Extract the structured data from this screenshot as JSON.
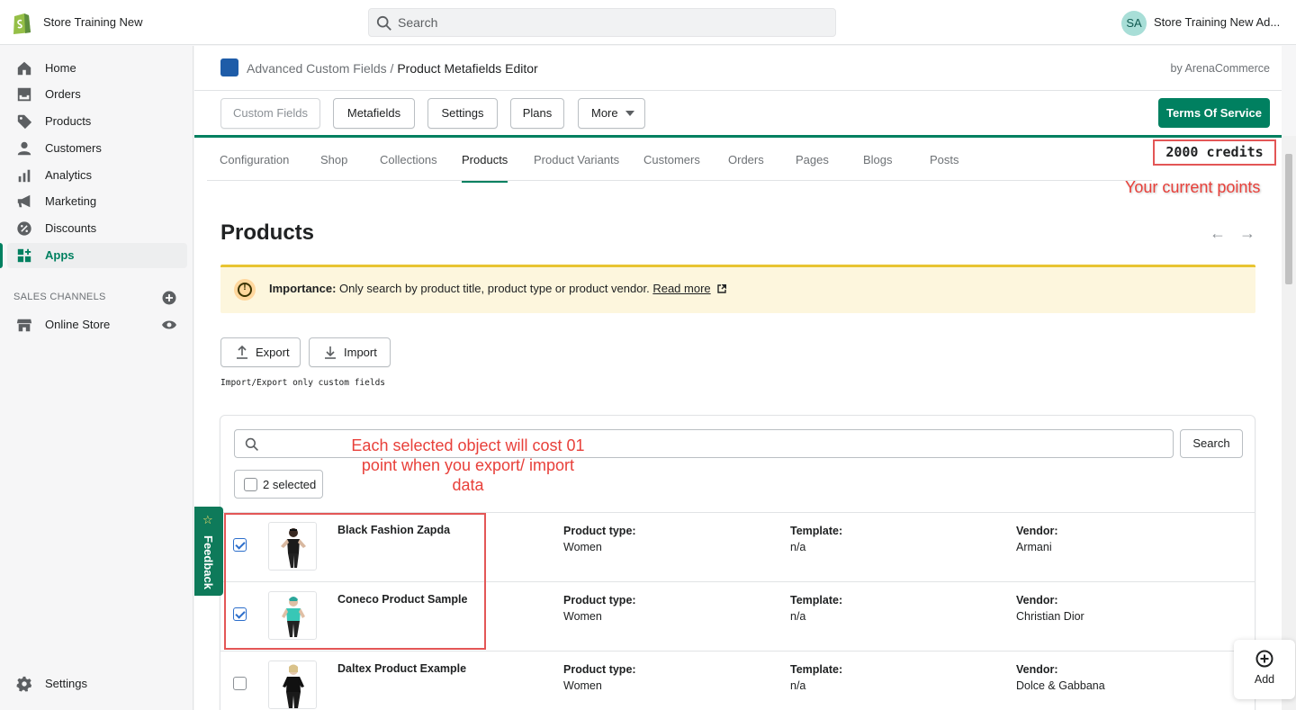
{
  "topbar": {
    "store_name": "Store Training New",
    "search_placeholder": "Search",
    "avatar_initials": "SA",
    "user_name": "Store Training New Ad..."
  },
  "sidebar": {
    "items": [
      {
        "label": "Home",
        "icon": "home-icon"
      },
      {
        "label": "Orders",
        "icon": "orders-icon"
      },
      {
        "label": "Products",
        "icon": "tag-icon"
      },
      {
        "label": "Customers",
        "icon": "person-icon"
      },
      {
        "label": "Analytics",
        "icon": "bar-chart-icon"
      },
      {
        "label": "Marketing",
        "icon": "megaphone-icon"
      },
      {
        "label": "Discounts",
        "icon": "discount-icon"
      },
      {
        "label": "Apps",
        "icon": "apps-icon"
      }
    ],
    "channels_title": "SALES CHANNELS",
    "online_store": "Online Store",
    "settings": "Settings"
  },
  "app": {
    "breadcrumb_parent": "Advanced Custom Fields",
    "breadcrumb_sep": " / ",
    "breadcrumb_current": "Product Metafields Editor",
    "byline": "by ArenaCommerce"
  },
  "toolbar": {
    "custom_fields": "Custom Fields",
    "metafields": "Metafields",
    "settings": "Settings",
    "plans": "Plans",
    "more": "More",
    "terms": "Terms Of Service"
  },
  "tabs": [
    "Configuration",
    "Shop",
    "Collections",
    "Products",
    "Product Variants",
    "Customers",
    "Orders",
    "Pages",
    "Blogs",
    "Posts"
  ],
  "credits": "2000 credits",
  "points_note": "Your current points",
  "page_title": "Products",
  "banner": {
    "label": "Importance:",
    "text": " Only search by product title, product type or product vendor. ",
    "link": "Read more"
  },
  "export_label": "Export",
  "import_label": "Import",
  "ie_note": "Import/Export only custom fields",
  "list": {
    "search_button": "Search",
    "selected": "2 selected",
    "cost_note": "Each selected object will cost 01 point when you export/ import data",
    "col_type": "Product type:",
    "col_template": "Template:",
    "col_vendor": "Vendor:",
    "rows": [
      {
        "name": "Black Fashion Zapda",
        "type": "Women",
        "template": "n/a",
        "vendor": "Armani",
        "checked": true
      },
      {
        "name": "Coneco Product Sample",
        "type": "Women",
        "template": "n/a",
        "vendor": "Christian Dior",
        "checked": true
      },
      {
        "name": "Daltex Product Example",
        "type": "Women",
        "template": "n/a",
        "vendor": "Dolce & Gabbana",
        "checked": false
      }
    ]
  },
  "feedback": "Feedback",
  "add_label": "Add",
  "colors": {
    "accent": "#008060",
    "annotation": "#e35656"
  }
}
